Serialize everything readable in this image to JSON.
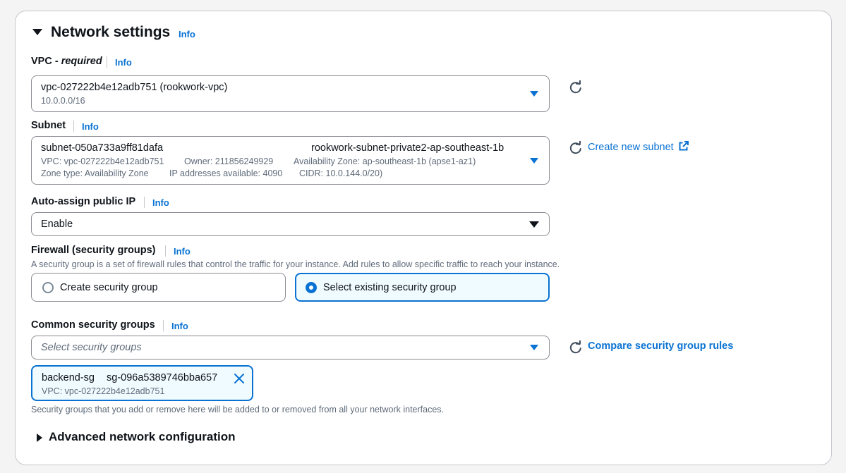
{
  "section": {
    "title": "Network settings",
    "info": "Info"
  },
  "vpc": {
    "label": "VPC - ",
    "required": "required",
    "info": "Info",
    "value": "vpc-027222b4e12adb751 (rookwork-vpc)",
    "sub": "10.0.0.0/16"
  },
  "subnet": {
    "label": "Subnet",
    "info": "Info",
    "id": "subnet-050a733a9ff81dafa",
    "name": "rookwork-subnet-private2-ap-southeast-1b",
    "line2_vpc": "VPC: vpc-027222b4e12adb751",
    "line2_owner": "Owner: 211856249929",
    "line2_az": "Availability Zone: ap-southeast-1b (apse1-az1)",
    "line3_type": "Zone type: Availability Zone",
    "line3_ips": "IP addresses available: 4090",
    "line3_cidr": "CIDR: 10.0.144.0/20)",
    "create_link": "Create new subnet"
  },
  "public_ip": {
    "label": "Auto-assign public IP",
    "info": "Info",
    "value": "Enable"
  },
  "firewall": {
    "label": "Firewall (security groups)",
    "info": "Info",
    "description": "A security group is a set of firewall rules that control the traffic for your instance. Add rules to allow specific traffic to reach your instance.",
    "option_create": "Create security group",
    "option_select": "Select existing security group",
    "selected": "Select existing security group"
  },
  "common_sg": {
    "label": "Common security groups",
    "info": "Info",
    "placeholder": "Select security groups",
    "compare_link": "Compare security group rules",
    "token_name": "backend-sg",
    "token_id": "sg-096a5389746bba657",
    "token_vpc": "VPC: vpc-027222b4e12adb751",
    "helper": "Security groups that you add or remove here will be added to or removed from all your network interfaces."
  },
  "advanced": {
    "title": "Advanced network configuration"
  },
  "icons": {
    "collapse": "caret-down-icon",
    "expand": "caret-right-icon",
    "refresh": "refresh-icon",
    "external": "external-link-icon",
    "remove": "close-icon"
  },
  "colors": {
    "accent": "#0972d3",
    "text": "#0f141a",
    "muted": "#5f6b7a",
    "selected_bg": "#f0fbff"
  }
}
